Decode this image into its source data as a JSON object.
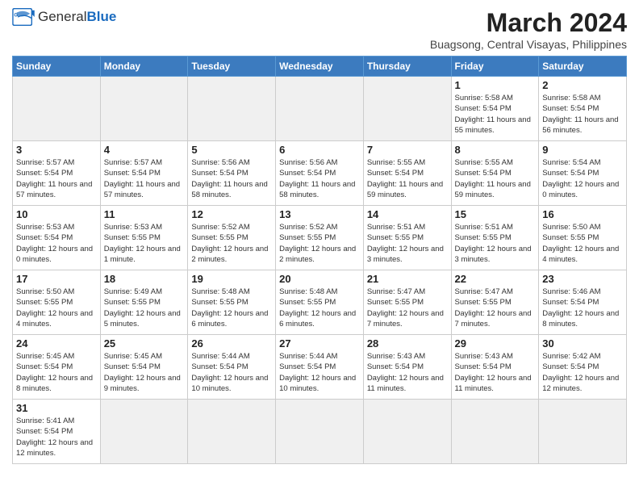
{
  "header": {
    "logo_general": "General",
    "logo_blue": "Blue",
    "month_year": "March 2024",
    "location": "Buagsong, Central Visayas, Philippines"
  },
  "weekdays": [
    "Sunday",
    "Monday",
    "Tuesday",
    "Wednesday",
    "Thursday",
    "Friday",
    "Saturday"
  ],
  "weeks": [
    [
      {
        "day": "",
        "info": "",
        "empty": true
      },
      {
        "day": "",
        "info": "",
        "empty": true
      },
      {
        "day": "",
        "info": "",
        "empty": true
      },
      {
        "day": "",
        "info": "",
        "empty": true
      },
      {
        "day": "",
        "info": "",
        "empty": true
      },
      {
        "day": "1",
        "info": "Sunrise: 5:58 AM\nSunset: 5:54 PM\nDaylight: 11 hours\nand 55 minutes."
      },
      {
        "day": "2",
        "info": "Sunrise: 5:58 AM\nSunset: 5:54 PM\nDaylight: 11 hours\nand 56 minutes."
      }
    ],
    [
      {
        "day": "3",
        "info": "Sunrise: 5:57 AM\nSunset: 5:54 PM\nDaylight: 11 hours\nand 57 minutes."
      },
      {
        "day": "4",
        "info": "Sunrise: 5:57 AM\nSunset: 5:54 PM\nDaylight: 11 hours\nand 57 minutes."
      },
      {
        "day": "5",
        "info": "Sunrise: 5:56 AM\nSunset: 5:54 PM\nDaylight: 11 hours\nand 58 minutes."
      },
      {
        "day": "6",
        "info": "Sunrise: 5:56 AM\nSunset: 5:54 PM\nDaylight: 11 hours\nand 58 minutes."
      },
      {
        "day": "7",
        "info": "Sunrise: 5:55 AM\nSunset: 5:54 PM\nDaylight: 11 hours\nand 59 minutes."
      },
      {
        "day": "8",
        "info": "Sunrise: 5:55 AM\nSunset: 5:54 PM\nDaylight: 11 hours\nand 59 minutes."
      },
      {
        "day": "9",
        "info": "Sunrise: 5:54 AM\nSunset: 5:54 PM\nDaylight: 12 hours\nand 0 minutes."
      }
    ],
    [
      {
        "day": "10",
        "info": "Sunrise: 5:53 AM\nSunset: 5:54 PM\nDaylight: 12 hours\nand 0 minutes."
      },
      {
        "day": "11",
        "info": "Sunrise: 5:53 AM\nSunset: 5:55 PM\nDaylight: 12 hours\nand 1 minute."
      },
      {
        "day": "12",
        "info": "Sunrise: 5:52 AM\nSunset: 5:55 PM\nDaylight: 12 hours\nand 2 minutes."
      },
      {
        "day": "13",
        "info": "Sunrise: 5:52 AM\nSunset: 5:55 PM\nDaylight: 12 hours\nand 2 minutes."
      },
      {
        "day": "14",
        "info": "Sunrise: 5:51 AM\nSunset: 5:55 PM\nDaylight: 12 hours\nand 3 minutes."
      },
      {
        "day": "15",
        "info": "Sunrise: 5:51 AM\nSunset: 5:55 PM\nDaylight: 12 hours\nand 3 minutes."
      },
      {
        "day": "16",
        "info": "Sunrise: 5:50 AM\nSunset: 5:55 PM\nDaylight: 12 hours\nand 4 minutes."
      }
    ],
    [
      {
        "day": "17",
        "info": "Sunrise: 5:50 AM\nSunset: 5:55 PM\nDaylight: 12 hours\nand 4 minutes."
      },
      {
        "day": "18",
        "info": "Sunrise: 5:49 AM\nSunset: 5:55 PM\nDaylight: 12 hours\nand 5 minutes."
      },
      {
        "day": "19",
        "info": "Sunrise: 5:48 AM\nSunset: 5:55 PM\nDaylight: 12 hours\nand 6 minutes."
      },
      {
        "day": "20",
        "info": "Sunrise: 5:48 AM\nSunset: 5:55 PM\nDaylight: 12 hours\nand 6 minutes."
      },
      {
        "day": "21",
        "info": "Sunrise: 5:47 AM\nSunset: 5:55 PM\nDaylight: 12 hours\nand 7 minutes."
      },
      {
        "day": "22",
        "info": "Sunrise: 5:47 AM\nSunset: 5:55 PM\nDaylight: 12 hours\nand 7 minutes."
      },
      {
        "day": "23",
        "info": "Sunrise: 5:46 AM\nSunset: 5:54 PM\nDaylight: 12 hours\nand 8 minutes."
      }
    ],
    [
      {
        "day": "24",
        "info": "Sunrise: 5:45 AM\nSunset: 5:54 PM\nDaylight: 12 hours\nand 8 minutes."
      },
      {
        "day": "25",
        "info": "Sunrise: 5:45 AM\nSunset: 5:54 PM\nDaylight: 12 hours\nand 9 minutes."
      },
      {
        "day": "26",
        "info": "Sunrise: 5:44 AM\nSunset: 5:54 PM\nDaylight: 12 hours\nand 10 minutes."
      },
      {
        "day": "27",
        "info": "Sunrise: 5:44 AM\nSunset: 5:54 PM\nDaylight: 12 hours\nand 10 minutes."
      },
      {
        "day": "28",
        "info": "Sunrise: 5:43 AM\nSunset: 5:54 PM\nDaylight: 12 hours\nand 11 minutes."
      },
      {
        "day": "29",
        "info": "Sunrise: 5:43 AM\nSunset: 5:54 PM\nDaylight: 12 hours\nand 11 minutes."
      },
      {
        "day": "30",
        "info": "Sunrise: 5:42 AM\nSunset: 5:54 PM\nDaylight: 12 hours\nand 12 minutes."
      }
    ],
    [
      {
        "day": "31",
        "info": "Sunrise: 5:41 AM\nSunset: 5:54 PM\nDaylight: 12 hours\nand 12 minutes."
      },
      {
        "day": "",
        "info": "",
        "empty": true
      },
      {
        "day": "",
        "info": "",
        "empty": true
      },
      {
        "day": "",
        "info": "",
        "empty": true
      },
      {
        "day": "",
        "info": "",
        "empty": true
      },
      {
        "day": "",
        "info": "",
        "empty": true
      },
      {
        "day": "",
        "info": "",
        "empty": true
      }
    ]
  ]
}
